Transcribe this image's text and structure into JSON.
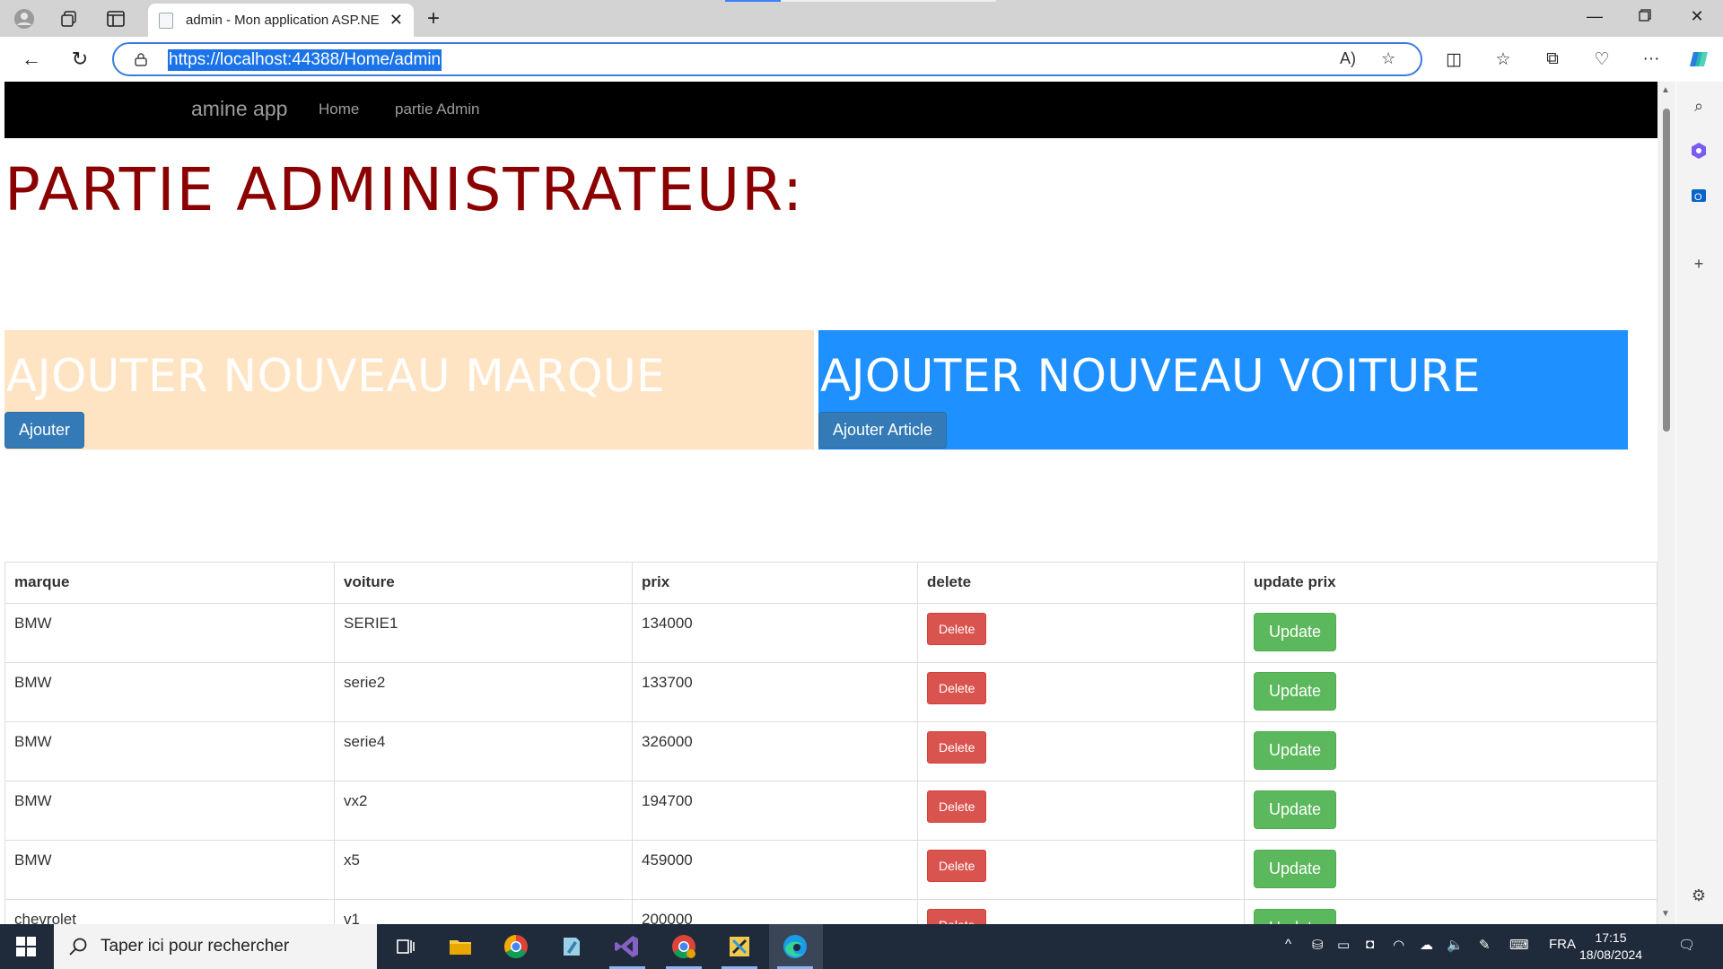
{
  "browser": {
    "tab_title": "admin - Mon application ASP.NE",
    "url": "https://localhost:44388/Home/admin"
  },
  "page": {
    "brand": "amine app",
    "nav": [
      "Home",
      "partie Admin"
    ],
    "title": "PARTIE ADMINISTRATEUR:",
    "panel_left": {
      "heading": "AJOUTER NOUVEAU MARQUE",
      "button": "Ajouter"
    },
    "panel_right": {
      "heading": "AJOUTER NOUVEAU VOITURE",
      "button": "Ajouter Article"
    },
    "table": {
      "headers": [
        "marque",
        "voiture",
        "prix",
        "delete",
        "update prix"
      ],
      "delete_label": "Delete",
      "update_label": "Update",
      "rows": [
        [
          "BMW",
          "SERIE1",
          "134000"
        ],
        [
          "BMW",
          "serie2",
          "133700"
        ],
        [
          "BMW",
          "serie4",
          "326000"
        ],
        [
          "BMW",
          "vx2",
          "194700"
        ],
        [
          "BMW",
          "x5",
          "459000"
        ],
        [
          "chevrolet",
          "v1",
          "200000"
        ]
      ]
    }
  },
  "taskbar": {
    "search_placeholder": "Taper ici pour rechercher",
    "language": "FRA",
    "time": "17:15",
    "date": "18/08/2024"
  },
  "colors": {
    "title_red": "#8b0000",
    "panel_left_bg": "#ffe4c4",
    "panel_right_bg": "#1e90ff",
    "btn_primary": "#337ab7",
    "btn_danger": "#d9534f",
    "btn_success": "#5cb85c"
  }
}
